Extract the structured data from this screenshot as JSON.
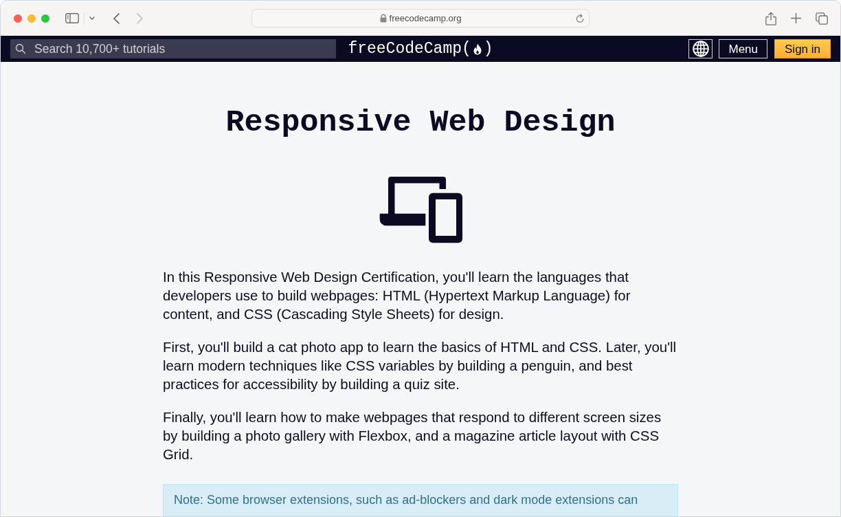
{
  "browser": {
    "back": {
      "disabled": false
    },
    "forward": {
      "disabled": true
    },
    "url": "freecodecamp.org"
  },
  "navbar": {
    "search": {
      "placeholder": "Search 10,700+ tutorials"
    },
    "logo": {
      "text_before_icon": "freeCodeCamp(",
      "text_after_icon": ")"
    },
    "buttons": [
      {
        "kind": "language"
      },
      {
        "kind": "menu",
        "label": "Menu"
      },
      {
        "kind": "signin",
        "label": "Sign in"
      }
    ]
  },
  "page": {
    "title": "Responsive Web Design",
    "paragraphs": [
      "In this Responsive Web Design Certification, you'll learn the languages that developers use to build webpages: HTML (Hypertext Markup Language) for content, and CSS (Cascading Style Sheets) for design.",
      "First, you'll build a cat photo app to learn the basics of HTML and CSS. Later, you'll learn modern techniques like CSS variables by building a penguin, and best practices for accessibility by building a quiz site.",
      "Finally, you'll learn how to make webpages that respond to different screen sizes by building a photo gallery with Flexbox, and a magazine article layout with CSS Grid."
    ],
    "note": "Note: Some browser extensions, such as ad-blockers and dark mode extensions can"
  }
}
